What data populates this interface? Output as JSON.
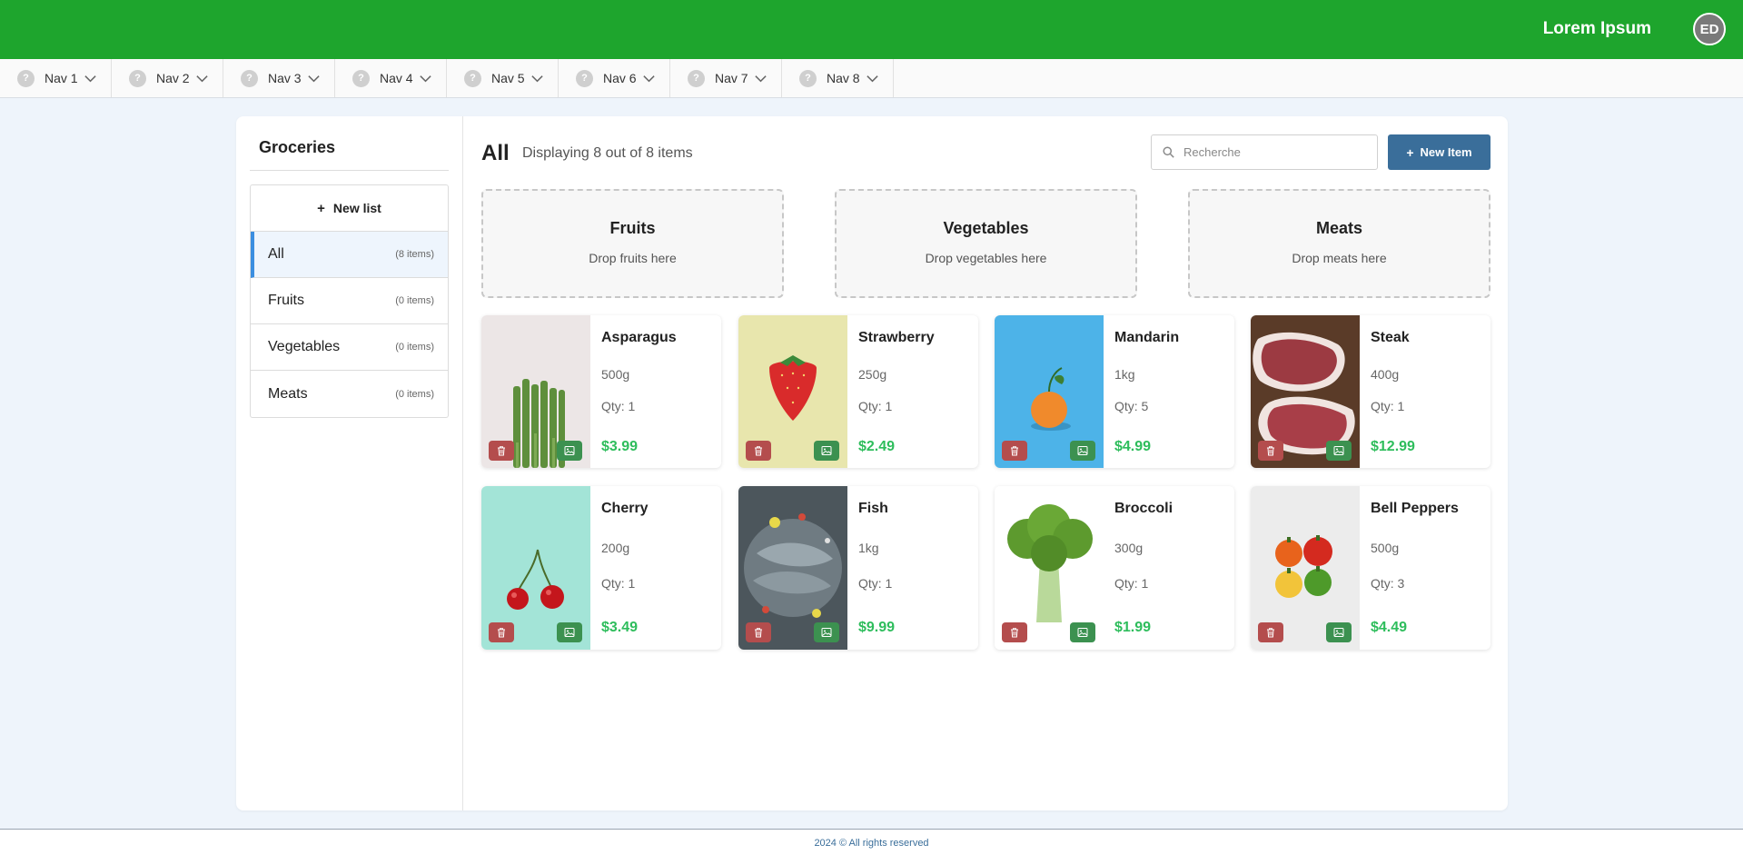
{
  "header": {
    "brand": "Lorem Ipsum",
    "avatar_initials": "ED",
    "color": "#1ea52d"
  },
  "nav": [
    {
      "label": "Nav 1",
      "icon": "question-icon"
    },
    {
      "label": "Nav 2",
      "icon": "question-icon"
    },
    {
      "label": "Nav 3",
      "icon": "question-icon"
    },
    {
      "label": "Nav 4",
      "icon": "question-icon"
    },
    {
      "label": "Nav 5",
      "icon": "question-icon"
    },
    {
      "label": "Nav 6",
      "icon": "question-icon"
    },
    {
      "label": "Nav 7",
      "icon": "question-icon"
    },
    {
      "label": "Nav 8",
      "icon": "question-icon"
    }
  ],
  "sidebar": {
    "title": "Groceries",
    "new_list": "New list",
    "lists": [
      {
        "label": "All",
        "count": "(8 items)",
        "active": true
      },
      {
        "label": "Fruits",
        "count": "(0 items)"
      },
      {
        "label": "Vegetables",
        "count": "(0 items)"
      },
      {
        "label": "Meats",
        "count": "(0 items)"
      }
    ]
  },
  "main": {
    "title": "All",
    "subtitle": "Displaying 8 out of 8 items",
    "search_placeholder": "Recherche",
    "new_item": "New Item",
    "drop_zones": [
      {
        "title": "Fruits",
        "hint": "Drop fruits here"
      },
      {
        "title": "Vegetables",
        "hint": "Drop vegetables here"
      },
      {
        "title": "Meats",
        "hint": "Drop meats here"
      }
    ],
    "items": [
      {
        "name": "Asparagus",
        "weight": "500g",
        "qty": "Qty: 1",
        "price": "$3.99"
      },
      {
        "name": "Strawberry",
        "weight": "250g",
        "qty": "Qty: 1",
        "price": "$2.49"
      },
      {
        "name": "Mandarin",
        "weight": "1kg",
        "qty": "Qty: 5",
        "price": "$4.99"
      },
      {
        "name": "Steak",
        "weight": "400g",
        "qty": "Qty: 1",
        "price": "$12.99"
      },
      {
        "name": "Cherry",
        "weight": "200g",
        "qty": "Qty: 1",
        "price": "$3.49"
      },
      {
        "name": "Fish",
        "weight": "1kg",
        "qty": "Qty: 1",
        "price": "$9.99"
      },
      {
        "name": "Broccoli",
        "weight": "300g",
        "qty": "Qty: 1",
        "price": "$1.99"
      },
      {
        "name": "Bell Peppers",
        "weight": "500g",
        "qty": "Qty: 3",
        "price": "$4.49"
      }
    ]
  },
  "footer": {
    "text": "2024 © All rights reserved"
  }
}
